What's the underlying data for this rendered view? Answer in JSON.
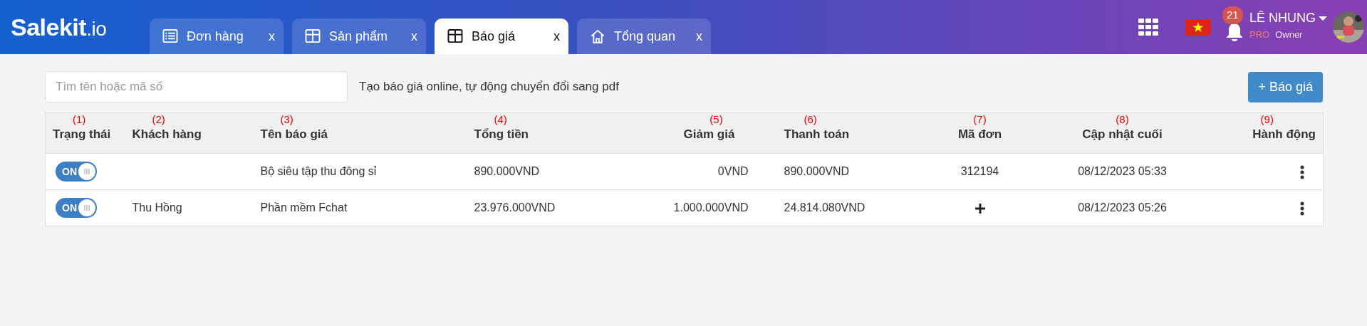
{
  "logo": {
    "text": "Salekit",
    "suffix": ".io"
  },
  "tabs": [
    {
      "label": "Đơn hàng",
      "kind": "list",
      "close": "x",
      "selected": false
    },
    {
      "label": "Sản phẩm",
      "kind": "table",
      "close": "x",
      "selected": false
    },
    {
      "label": "Báo giá",
      "kind": "table",
      "close": "x",
      "selected": true
    },
    {
      "label": "Tổng quan",
      "kind": "home",
      "close": "x",
      "selected": false
    }
  ],
  "notifications": {
    "count": "21"
  },
  "user": {
    "name": "LÊ NHUNG",
    "plan": "PRO",
    "role": "Owner"
  },
  "search": {
    "placeholder": "Tìm tên hoặc mã số"
  },
  "hint": "Tạo báo giá online, tự động chuyển đổi sang pdf",
  "add_button": {
    "icon": "+",
    "label": "Báo giá"
  },
  "table": {
    "columns": [
      {
        "label": "Trạng thái",
        "marker": "(1)"
      },
      {
        "label": "Khách hàng",
        "marker": "(2)"
      },
      {
        "label": "Tên báo giá",
        "marker": "(3)"
      },
      {
        "label": "Tổng tiền",
        "marker": "(4)"
      },
      {
        "label": "Giảm giá",
        "marker": "(5)"
      },
      {
        "label": "Thanh toán",
        "marker": "(6)"
      },
      {
        "label": "Mã đơn",
        "marker": "(7)"
      },
      {
        "label": "Cập nhật cuối",
        "marker": "(8)"
      },
      {
        "label": "Hành động",
        "marker": "(9)"
      }
    ],
    "rows": [
      {
        "status": {
          "on": true,
          "label": "ON"
        },
        "customer": "",
        "name": "Bộ siêu tập thu đông sỉ",
        "total": "890.000VND",
        "discount": "0VND",
        "payment": "890.000VND",
        "order": {
          "kind": "code",
          "text": "312194"
        },
        "updated": "08/12/2023 05:33"
      },
      {
        "status": {
          "on": true,
          "label": "ON"
        },
        "customer": "Thu Hồng",
        "name": "Phần mềm Fchat",
        "total": "23.976.000VND",
        "discount": "1.000.000VND",
        "payment": "24.814.080VND",
        "order": {
          "kind": "add"
        },
        "updated": "08/12/2023 05:26"
      }
    ]
  }
}
